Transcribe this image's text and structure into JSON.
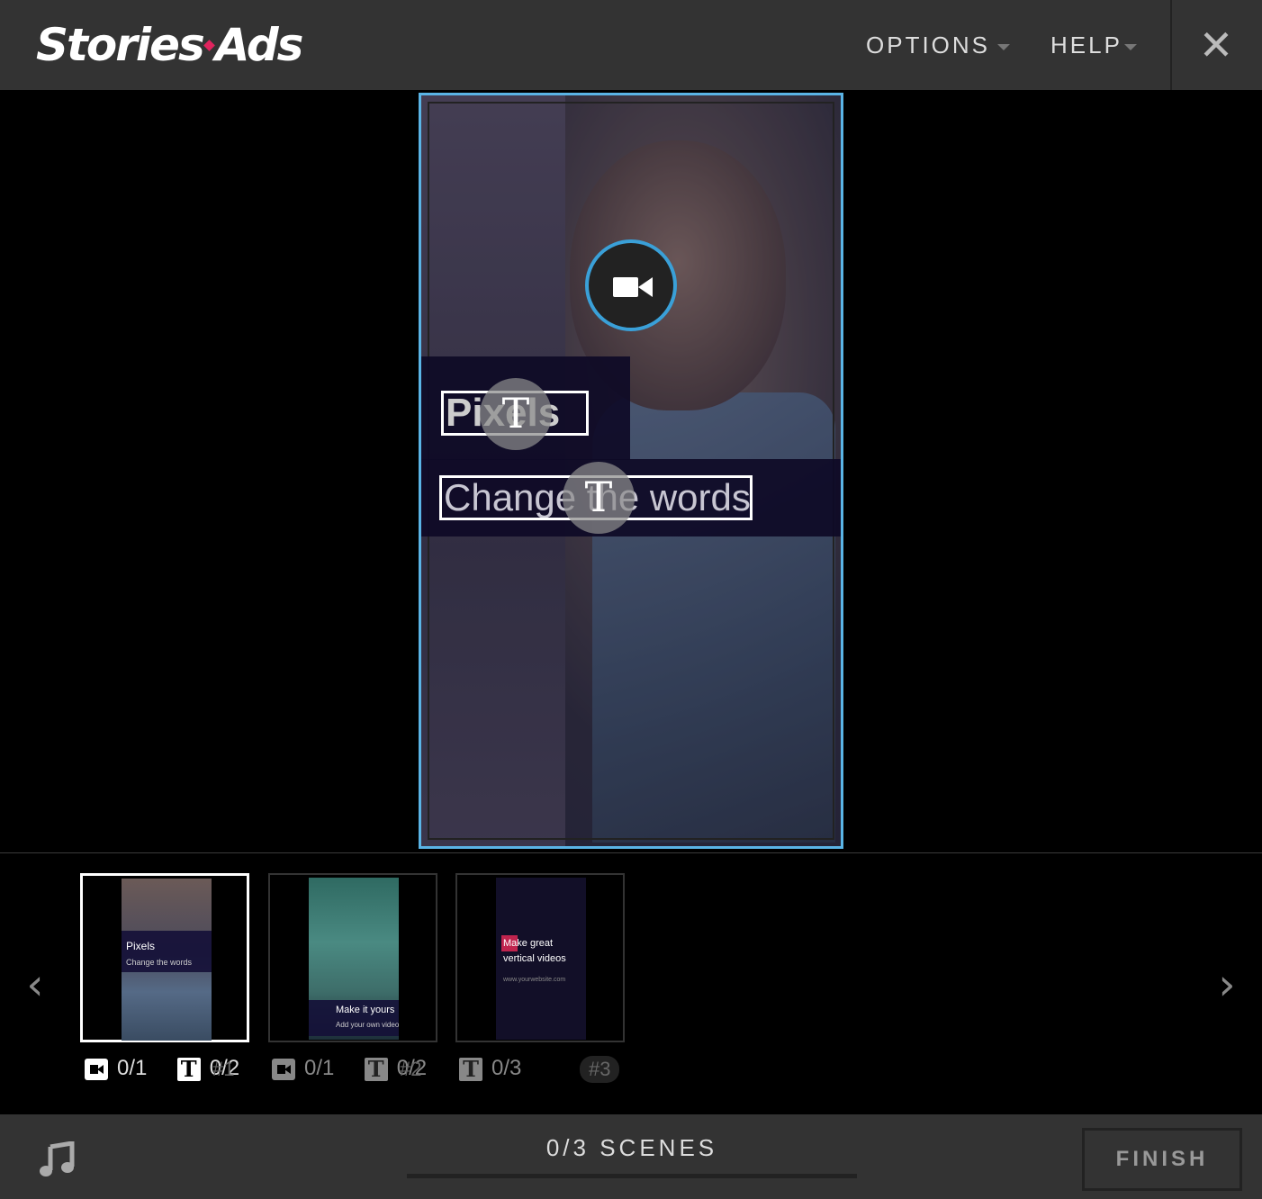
{
  "header": {
    "logo_left": "Stories",
    "logo_right": "Ads",
    "options_label": "OPTIONS",
    "help_label": "HELP",
    "close_glyph": "✕"
  },
  "canvas": {
    "title_text": "Pixels",
    "subtitle_text": "Change the words",
    "text_edit_glyph": "T",
    "accent_color": "#5ab4e6"
  },
  "scenes": [
    {
      "title": "Pixels",
      "subtitle": "Change the words",
      "video_count": "0/1",
      "text_count": "0/2",
      "number": "#1",
      "active": true
    },
    {
      "title": "Make it yours",
      "subtitle": "Add your own video",
      "video_count": "0/1",
      "text_count": "0/2",
      "number": "#2",
      "active": false
    },
    {
      "title_line1": "Make great",
      "title_line2": "vertical videos",
      "subtitle": "www.yourwebsite.com",
      "text_count": "0/3",
      "number": "#3",
      "active": false
    }
  ],
  "nav": {
    "prev_glyph": "‹",
    "next_glyph": "›"
  },
  "footer": {
    "scenes_label": "0/3 SCENES",
    "progress": 0,
    "finish_label": "FINISH",
    "music_icon": "music-note-icon"
  }
}
